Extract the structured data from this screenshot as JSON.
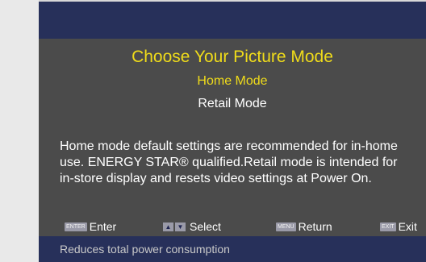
{
  "menu": {
    "title": "Choose Your Picture Mode",
    "options": [
      "Home Mode",
      "Retail Mode"
    ],
    "selected": "Home Mode",
    "description_lines": [
      "Home mode default settings are recommended for in-home",
      "use. ENERGY STAR® qualified.Retail mode is intended for",
      "in-store display and resets video settings at Power On."
    ]
  },
  "help_bar": {
    "enter": {
      "key": "ENTER",
      "label": "Enter"
    },
    "select": {
      "up_icon": "▲",
      "down_icon": "▼",
      "label": "Select"
    },
    "return": {
      "key": "MENU",
      "label": "Return"
    },
    "exit": {
      "key": "EXIT",
      "label": "Exit"
    }
  },
  "status": {
    "text": "Reduces total power consumption"
  },
  "colors": {
    "page_bg": "#e9e9e9",
    "panel_bg": "#4b4b4b",
    "bar_bg": "#27305a",
    "highlight": "#f0dc1a",
    "text": "#ffffff",
    "status_text": "#c9c9c9",
    "key_bg": "#9a9aa8"
  }
}
